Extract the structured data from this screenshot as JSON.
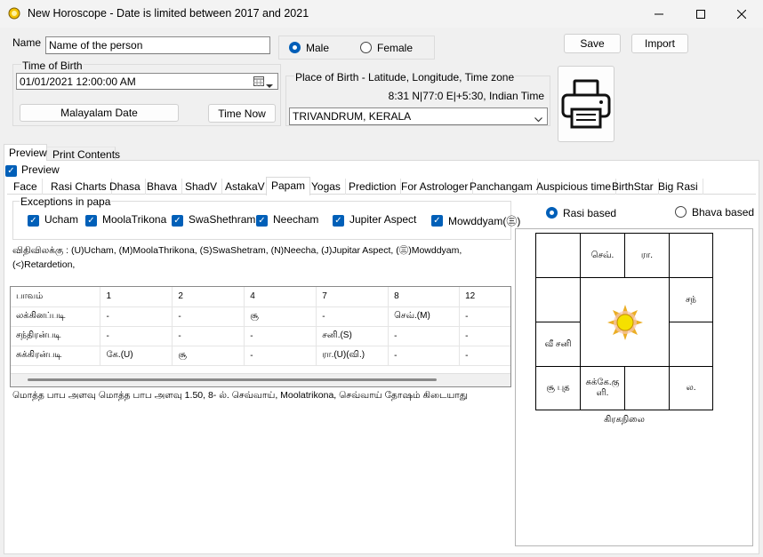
{
  "window": {
    "title": "New Horoscope - Date is limited between 2017 and 2021",
    "minimize": "—",
    "maximize": "☐",
    "close": "✕"
  },
  "form": {
    "name_label": "Name",
    "name_value": "Name of the person",
    "gender_male": "Male",
    "gender_female": "Female",
    "gender_selected": "Male",
    "save": "Save",
    "import": "Import",
    "tob_label": "Time of Birth",
    "tob_value": "01/01/2021  12:00:00 AM",
    "malayalam_date": "Malayalam Date",
    "time_now": "Time Now",
    "pob_label": "Place of Birth - Latitude, Longitude, Time zone",
    "pob_coords": "8:31 N|77:0 E|+5:30, Indian Time",
    "pob_value": "TRIVANDRUM, KERALA"
  },
  "outer_tabs": [
    "Preview",
    "Print Contents"
  ],
  "preview_checkbox": "Preview",
  "inner_tabs": [
    "Face",
    "Rasi Charts",
    "Dhasa",
    "Bhava",
    "ShadV",
    "AstakaV",
    "Papam",
    "Yogas",
    "Prediction",
    "For Astrologer",
    "Panchangam",
    "Auspicious time",
    "BirthStar",
    "Big Rasi"
  ],
  "active_tab": "Papam",
  "exceptions": {
    "legend": "Exceptions in papa",
    "items": [
      "Ucham",
      "MoolaTrikona",
      "SwaShethram",
      "Neecham",
      "Jupiter Aspect",
      "Mowddyam(㊂)"
    ]
  },
  "legend_text": {
    "line1": "விதிவிலக்கு : (U)Ucham,  (M)MoolaThrikona,  (S)SwaShetram, (N)Neecha,  (J)Jupitar Aspect,  (㊂)Mowddyam,",
    "line2": "(<)Retardetion,"
  },
  "papa_table": {
    "header": [
      "பாவம்",
      "1",
      "2",
      "4",
      "7",
      "8",
      "12"
    ],
    "rows": [
      [
        "லக்கினப்படி",
        "-",
        "-",
        "சூ",
        "-",
        "செவ்.(M)",
        "-"
      ],
      [
        "சந்திரன்படி",
        "-",
        "-",
        "-",
        "சனி.(S)",
        "-",
        "-"
      ],
      [
        "சுக்கிரன்படி",
        "கே.(U)",
        "சூ",
        "-",
        "ரா.(U)(வி.)",
        "-",
        "-"
      ]
    ]
  },
  "summary": "மொத்த பாப அளவு மொத்த பாப அளவு  1.50,  8- ல். செவ்வாய், Moolatrikona, செவ்வாய் தோஷம் கிடையாது",
  "chart": {
    "rasi_based": "Rasi based",
    "bhava_based": "Bhava based",
    "selected": "Rasi based",
    "caption": "கிரகநிலை",
    "cells": {
      "r0c1": "செவ்.",
      "r0c2": "ரா.",
      "r1c3": "சந்",
      "r2c0": "வீ சனி",
      "r3c0": "சூ புத",
      "r3c1": "சுக்கே.கு ளி.",
      "r3c3": "ல."
    }
  }
}
